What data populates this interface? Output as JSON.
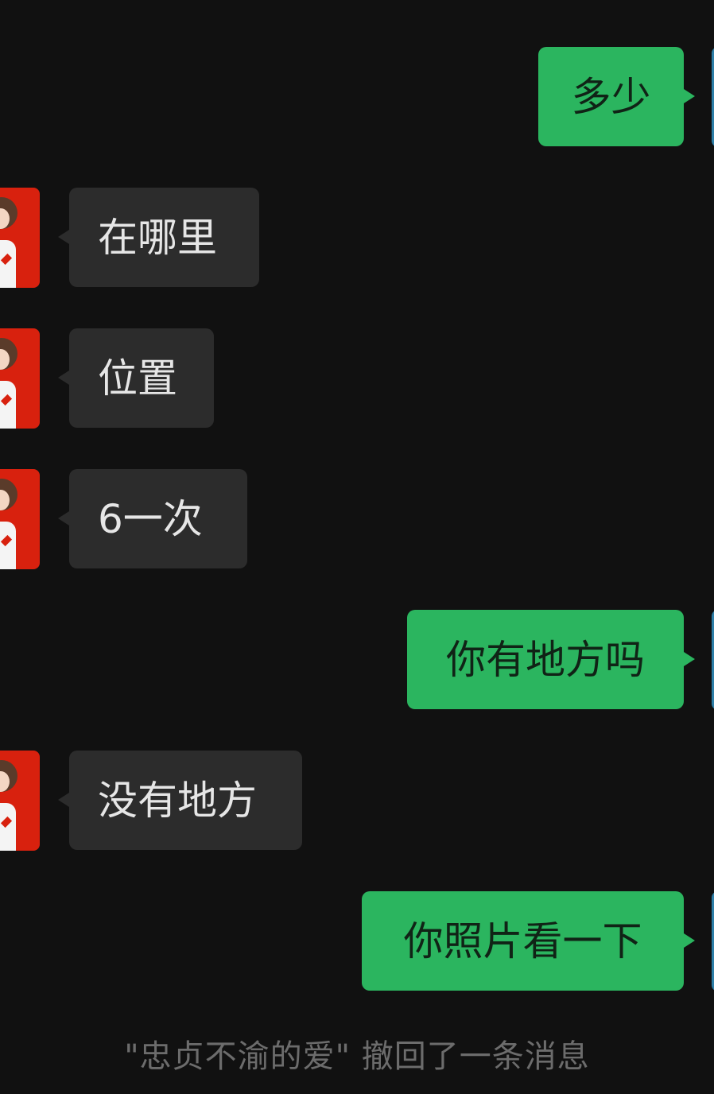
{
  "messages": [
    {
      "direction": "out",
      "text": "多少"
    },
    {
      "direction": "in",
      "text": "在哪里"
    },
    {
      "direction": "in",
      "text": "位置"
    },
    {
      "direction": "in",
      "text": "6一次"
    },
    {
      "direction": "out",
      "text": "你有地方吗"
    },
    {
      "direction": "in",
      "text": "没有地方"
    },
    {
      "direction": "out",
      "text": "你照片看一下"
    }
  ],
  "system_notice": "\"忠贞不渝的爱\" 撤回了一条消息",
  "colors": {
    "background": "#111111",
    "outgoing_bubble": "#2bb55f",
    "incoming_bubble": "#2c2c2c",
    "system_text": "#6c6c6c"
  }
}
